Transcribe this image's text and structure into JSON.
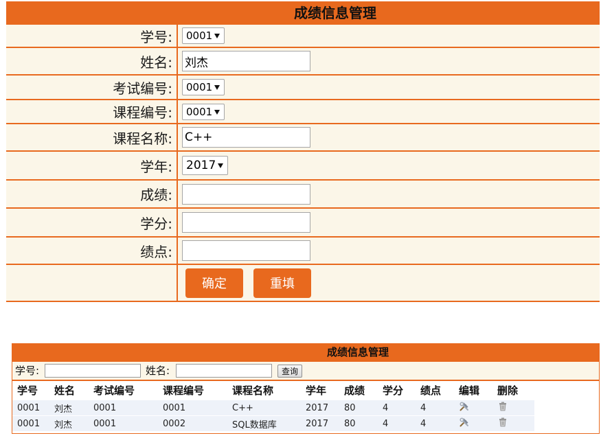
{
  "form": {
    "title": "成绩信息管理",
    "fields": [
      {
        "label": "学号:",
        "type": "select",
        "value": "0001"
      },
      {
        "label": "姓名:",
        "type": "text",
        "value": "刘杰"
      },
      {
        "label": "考试编号:",
        "type": "select",
        "value": "0001"
      },
      {
        "label": "课程编号:",
        "type": "select",
        "value": "0001"
      },
      {
        "label": "课程名称:",
        "type": "text",
        "value": "C++"
      },
      {
        "label": "学年:",
        "type": "select",
        "value": "2017"
      },
      {
        "label": "成绩:",
        "type": "text",
        "value": ""
      },
      {
        "label": "学分:",
        "type": "text",
        "value": ""
      },
      {
        "label": "绩点:",
        "type": "text",
        "value": ""
      }
    ],
    "confirm_label": "确定",
    "reset_label": "重填"
  },
  "list": {
    "title": "成绩信息管理",
    "search": {
      "student_id_label": "学号:",
      "student_id_value": "",
      "name_label": "姓名:",
      "name_value": "",
      "query_label": "查询"
    },
    "columns": [
      "学号",
      "姓名",
      "考试编号",
      "课程编号",
      "课程名称",
      "学年",
      "成绩",
      "学分",
      "绩点",
      "编辑",
      "删除"
    ],
    "rows": [
      {
        "student_id": "0001",
        "name": "刘杰",
        "exam_id": "0001",
        "course_id": "0001",
        "course_name": "C++",
        "year": "2017",
        "score": "80",
        "credit": "4",
        "gpa": "4"
      },
      {
        "student_id": "0001",
        "name": "刘杰",
        "exam_id": "0001",
        "course_id": "0002",
        "course_name": "SQL数据库",
        "year": "2017",
        "score": "80",
        "credit": "4",
        "gpa": "4"
      }
    ]
  },
  "icons": {
    "dropdown": "dropdown-arrow-icon",
    "edit": "edit-tools-icon",
    "delete": "trash-icon"
  },
  "colors": {
    "accent": "#E8691E",
    "form_row_bg": "#FBF6E8",
    "data_row_bg": "#EEF2F9"
  }
}
